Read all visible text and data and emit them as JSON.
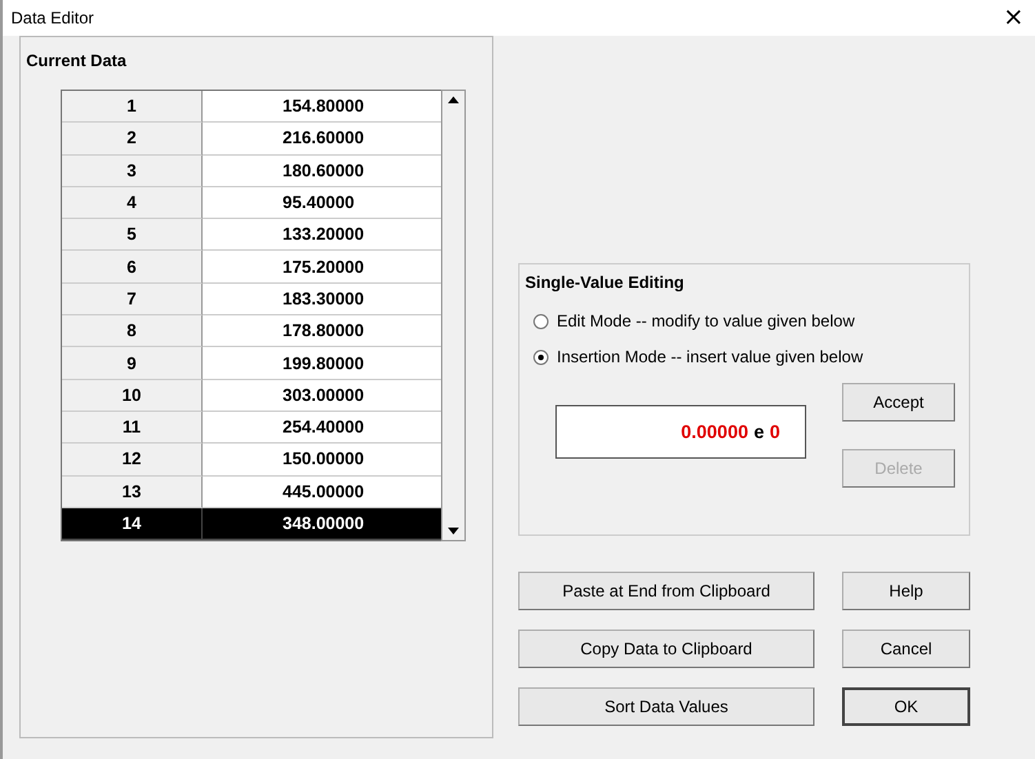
{
  "window": {
    "title": "Data Editor",
    "close": "×"
  },
  "current_data": {
    "title": "Current Data",
    "rows": [
      {
        "index": "1",
        "value": "154.80000",
        "selected": false
      },
      {
        "index": "2",
        "value": "216.60000",
        "selected": false
      },
      {
        "index": "3",
        "value": "180.60000",
        "selected": false
      },
      {
        "index": "4",
        "value": "95.40000",
        "selected": false
      },
      {
        "index": "5",
        "value": "133.20000",
        "selected": false
      },
      {
        "index": "6",
        "value": "175.20000",
        "selected": false
      },
      {
        "index": "7",
        "value": "183.30000",
        "selected": false
      },
      {
        "index": "8",
        "value": "178.80000",
        "selected": false
      },
      {
        "index": "9",
        "value": "199.80000",
        "selected": false
      },
      {
        "index": "10",
        "value": "303.00000",
        "selected": false
      },
      {
        "index": "11",
        "value": "254.40000",
        "selected": false
      },
      {
        "index": "12",
        "value": "150.00000",
        "selected": false
      },
      {
        "index": "13",
        "value": "445.00000",
        "selected": false
      },
      {
        "index": "14",
        "value": "348.00000",
        "selected": true
      }
    ]
  },
  "single_value_editing": {
    "title": "Single-Value Editing",
    "modes": [
      {
        "label": "Edit Mode -- modify to value given below",
        "selected": false
      },
      {
        "label": "Insertion Mode -- insert value given below",
        "selected": true
      }
    ],
    "value": {
      "mantissa": "0.00000",
      "separator": "e",
      "exponent": "0"
    },
    "buttons": [
      {
        "label": "Accept",
        "disabled": false
      },
      {
        "label": "Delete",
        "disabled": true
      }
    ]
  },
  "actions": [
    {
      "label": "Paste at End from Clipboard",
      "default": false
    },
    {
      "label": "Help",
      "default": false
    },
    {
      "label": "Copy Data to Clipboard",
      "default": false
    },
    {
      "label": "Cancel",
      "default": false
    },
    {
      "label": "Sort Data Values",
      "default": false
    },
    {
      "label": "OK",
      "default": true
    }
  ]
}
